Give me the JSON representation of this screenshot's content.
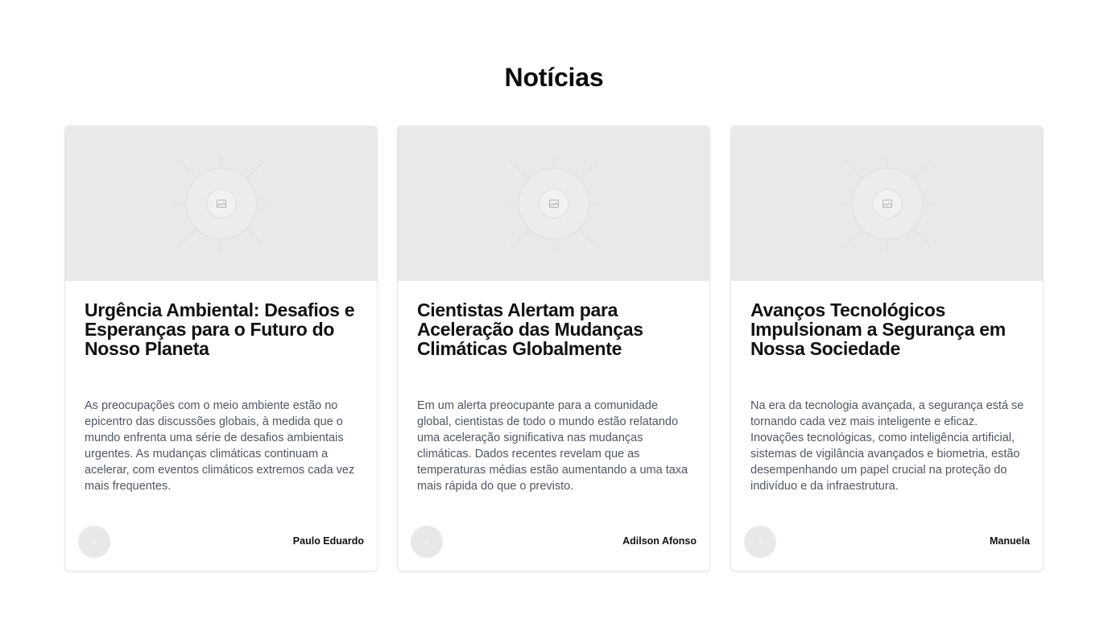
{
  "page": {
    "title": "Notícias"
  },
  "articles": [
    {
      "title": "Urgência Ambiental: Desafios e Esperanças para o Futuro do Nosso Planeta",
      "text": "As preocupações com o meio ambiente estão no epicentro das discussões globais, à medida que o mundo enfrenta uma série de desafios ambientais urgentes. As mudanças climáticas continuam a acelerar, com eventos climáticos extremos cada vez mais frequentes.",
      "author": "Paulo Eduardo",
      "image_icon": "image-placeholder-icon"
    },
    {
      "title": "Cientistas Alertam para Aceleração das Mudanças Climáticas Globalmente",
      "text": "Em um alerta preocupante para a comunidade global, cientistas de todo o mundo estão relatando uma aceleração significativa nas mudanças climáticas. Dados recentes revelam que as temperaturas médias estão aumentando a uma taxa mais rápida do que o previsto.",
      "author": "Adilson Afonso",
      "image_icon": "image-placeholder-icon"
    },
    {
      "title": "Avanços Tecnológicos Impulsionam a Segurança em Nossa Sociedade",
      "text": "Na era da tecnologia avançada, a segurança está se tornando cada vez mais inteligente e eficaz. Inovações tecnológicas, como inteligência artificial, sistemas de vigilância avançados e biometria, estão desempenhando um papel crucial na proteção do indivíduo e da infraestrutura.",
      "author": "Manuela",
      "image_icon": "image-placeholder-icon"
    }
  ]
}
